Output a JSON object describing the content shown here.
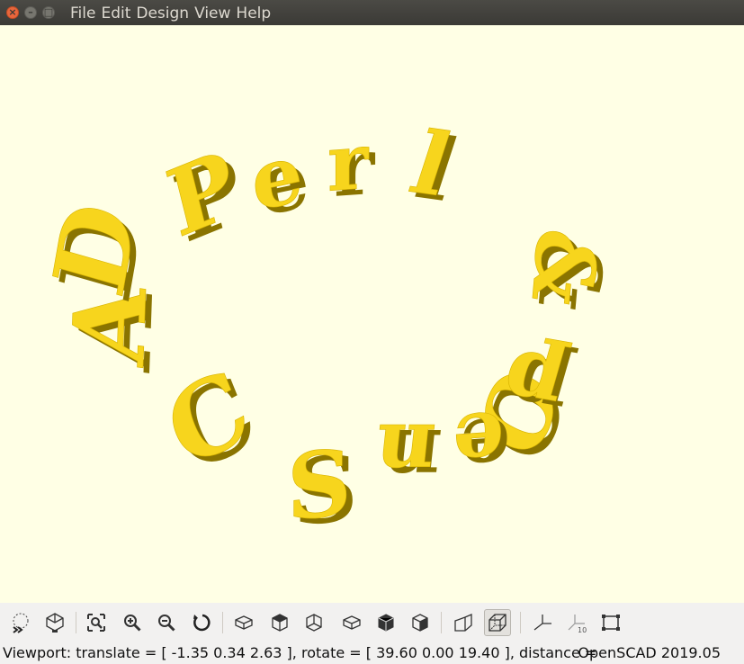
{
  "window": {
    "title": "",
    "menu": [
      "File",
      "Edit",
      "Design",
      "View",
      "Help"
    ],
    "controls": {
      "close": "×",
      "minimize": "–",
      "maximize": "□"
    }
  },
  "viewport": {
    "background": "#ffffe5",
    "model_color": "#f7d51d",
    "letters": [
      "P",
      "e",
      "r",
      "l",
      "&",
      "O",
      "p",
      "e",
      "n",
      "S",
      "C",
      "A",
      "D"
    ]
  },
  "toolbar": {
    "buttons": [
      {
        "name": "preview-icon",
        "active": false
      },
      {
        "name": "render-icon",
        "active": false
      },
      {
        "name": "view-all-icon",
        "active": false
      },
      {
        "name": "zoom-in-icon",
        "active": false
      },
      {
        "name": "zoom-out-icon",
        "active": false
      },
      {
        "name": "reset-view-icon",
        "active": false
      },
      {
        "name": "view-right-icon",
        "active": false
      },
      {
        "name": "view-top-icon",
        "active": false
      },
      {
        "name": "view-bottom-icon",
        "active": false
      },
      {
        "name": "view-left-icon",
        "active": false
      },
      {
        "name": "view-front-icon",
        "active": false
      },
      {
        "name": "view-back-icon",
        "active": false
      },
      {
        "name": "perspective-icon",
        "active": false
      },
      {
        "name": "orthogonal-icon",
        "active": true
      },
      {
        "name": "show-axes-icon",
        "active": false
      },
      {
        "name": "show-scale-markers-icon",
        "active": false
      },
      {
        "name": "show-edges-icon",
        "active": false
      }
    ],
    "scale_marker_label": "10"
  },
  "status": {
    "viewport": "Viewport: translate = [ -1.35 0.34 2.63 ], rotate = [ 39.60 0.00 19.40 ], distance = ",
    "version": "OpenSCAD 2019.05"
  }
}
